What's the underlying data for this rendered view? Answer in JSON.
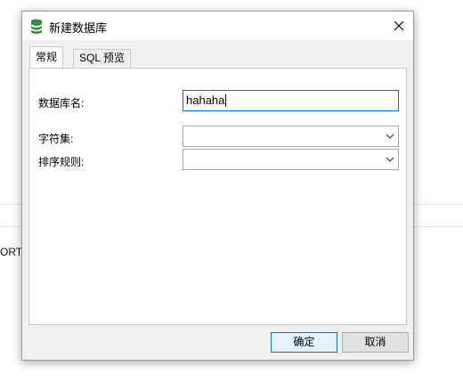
{
  "background": {
    "partial_text": "ORT="
  },
  "dialog": {
    "title": "新建数据库",
    "icon": "database-icon",
    "close_icon": "close-icon"
  },
  "tabs": [
    {
      "label": "常规",
      "active": true
    },
    {
      "label": "SQL 预览",
      "active": false
    }
  ],
  "form": {
    "db_name_label": "数据库名:",
    "db_name_value": "hahaha",
    "charset_label": "字符集:",
    "charset_value": "",
    "collation_label": "排序规则:",
    "collation_value": ""
  },
  "buttons": {
    "ok_label": "确定",
    "cancel_label": "取消"
  },
  "colors": {
    "accent": "#0078d7",
    "icon_green": "#2e8b3a"
  }
}
